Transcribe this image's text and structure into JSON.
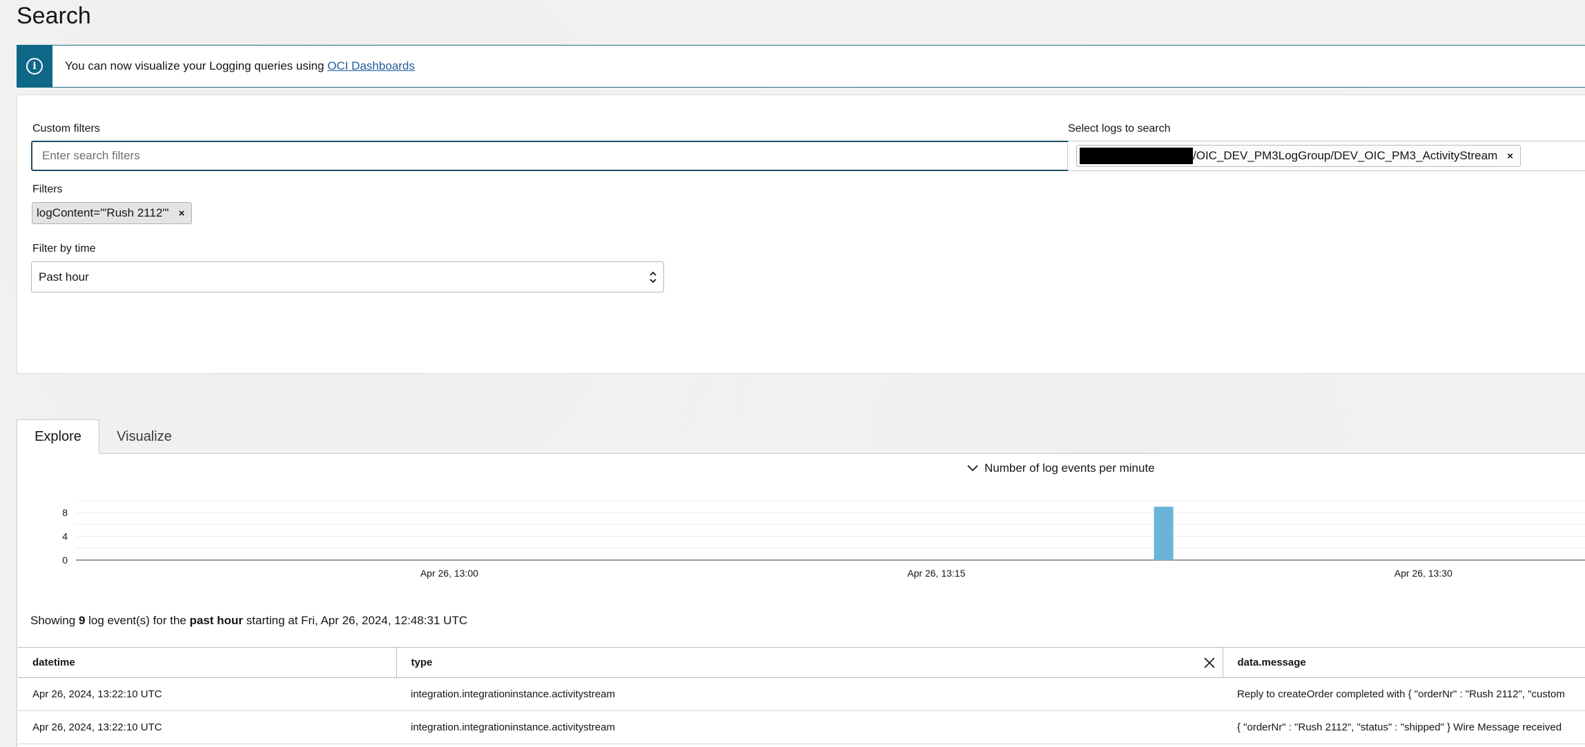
{
  "page": {
    "title": "Search"
  },
  "banner": {
    "icon": "info-icon",
    "text": "You can now visualize your Logging queries using ",
    "link": "OCI Dashboards"
  },
  "filters": {
    "custom_label": "Custom filters",
    "custom_placeholder": "Enter search filters",
    "custom_value": "",
    "logs_label": "Select logs to search",
    "selected_log": "/OIC_DEV_PM3LogGroup/DEV_OIC_PM3_ActivityStream",
    "filters_label": "Filters",
    "active_filter": "logContent='\"Rush 2112\"'",
    "time_label": "Filter by time",
    "time_value": "Past hour"
  },
  "tabs": {
    "explore": "Explore",
    "visualize": "Visualize",
    "active": "explore"
  },
  "chart_data": {
    "type": "bar",
    "title": "Number of log events per minute",
    "x_tick_labels": [
      "Apr 26, 13:00",
      "Apr 26, 13:15",
      "Apr 26, 13:30"
    ],
    "y_ticks": [
      0,
      4,
      8
    ],
    "ylim": [
      0,
      10
    ],
    "x_start_minute": 48.5,
    "x_end_minute": 95.0,
    "bars": [
      {
        "minute": 82.0,
        "value": 9
      }
    ],
    "bar_color": "#6bb4d9",
    "grid": true
  },
  "summary": {
    "prefix": "Showing ",
    "count": "9",
    "middle": " log event(s) for the ",
    "range": "past hour",
    "suffix": " starting at Fri, Apr 26, 2024, 12:48:31 UTC"
  },
  "table": {
    "columns": [
      "datetime",
      "type",
      "data.message"
    ],
    "rows": [
      {
        "datetime": "Apr 26, 2024, 13:22:10 UTC",
        "type": "integration.integrationinstance.activitystream",
        "message": "Reply to createOrder completed with { \"orderNr\" : \"Rush 2112\", \"custom"
      },
      {
        "datetime": "Apr 26, 2024, 13:22:10 UTC",
        "type": "integration.integrationinstance.activitystream",
        "message": "{ \"orderNr\" : \"Rush 2112\", \"status\" : \"shipped\" } Wire Message received"
      }
    ]
  }
}
